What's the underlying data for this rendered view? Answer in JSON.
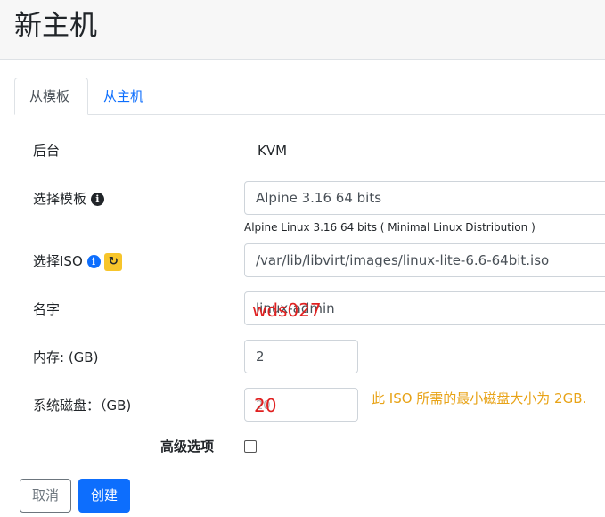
{
  "page": {
    "title": "新主机"
  },
  "tabs": [
    {
      "label": "从模板",
      "active": true
    },
    {
      "label": "从主机",
      "active": false
    }
  ],
  "form": {
    "backend": {
      "label": "后台",
      "value": "KVM"
    },
    "template": {
      "label": "选择模板",
      "value": "Alpine 3.16 64 bits",
      "description": "Alpine Linux 3.16 64 bits ( Minimal Linux Distribution )",
      "info_icon": "info-circle-icon"
    },
    "iso": {
      "label": "选择ISO",
      "value": "/var/lib/libvirt/images/linux-lite-6.6-64bit.iso",
      "info_icon": "info-circle-icon",
      "refresh_icon": "refresh-icon"
    },
    "name": {
      "label": "名字",
      "value": "linux-admin",
      "overlay_text": "wds027"
    },
    "memory": {
      "label": "内存: (GB)",
      "value": "2"
    },
    "disk": {
      "label": "系统磁盘：（GB)",
      "value": "20",
      "overlay_text": "20",
      "warning": "此 ISO 所需的最小磁盘大小为 2GB."
    },
    "advanced": {
      "label": "高级选项",
      "checked": false
    }
  },
  "buttons": {
    "cancel": "取消",
    "create": "创建"
  },
  "colors": {
    "primary": "#0d6efd",
    "warning": "#e8a317",
    "refresh_badge": "#f7c52b",
    "annotation_red": "#e02020"
  }
}
